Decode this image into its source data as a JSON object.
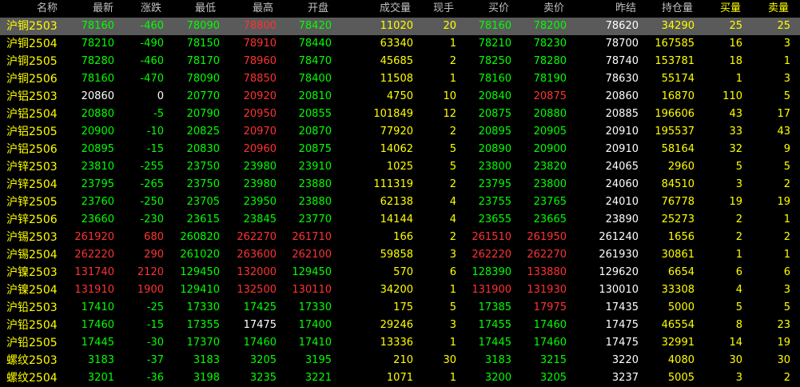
{
  "header": {
    "name": "名称",
    "latest": "最新",
    "change": "涨跌",
    "low": "最低",
    "high": "最高",
    "open": "开盘",
    "volume": "成交量",
    "current_hand": "现手",
    "bid": "买价",
    "ask": "卖价",
    "prev_settle": "昨结",
    "open_interest": "持仓量",
    "bid_vol": "买量",
    "ask_vol": "卖量"
  },
  "colors": {
    "up": "#ff3232",
    "down": "#00ff00",
    "flat": "#ffffff",
    "name": "#ffff00",
    "selected_row_bg": "#5a5a5a"
  },
  "rows": [
    {
      "name": "沪铜2503",
      "latest": "78160",
      "change": "-460",
      "low": "78090",
      "high": "78800",
      "open": "78420",
      "volume": "11020",
      "current_hand": "20",
      "bid": "78160",
      "ask": "78200",
      "prev_settle": "78620",
      "open_interest": "34290",
      "bid_vol": "25",
      "ask_vol": "25"
    },
    {
      "name": "沪铜2504",
      "latest": "78210",
      "change": "-490",
      "low": "78150",
      "high": "78910",
      "open": "78440",
      "volume": "63340",
      "current_hand": "1",
      "bid": "78210",
      "ask": "78230",
      "prev_settle": "78700",
      "open_interest": "167585",
      "bid_vol": "16",
      "ask_vol": "3"
    },
    {
      "name": "沪铜2505",
      "latest": "78280",
      "change": "-460",
      "low": "78170",
      "high": "78960",
      "open": "78470",
      "volume": "45685",
      "current_hand": "2",
      "bid": "78250",
      "ask": "78280",
      "prev_settle": "78740",
      "open_interest": "153781",
      "bid_vol": "18",
      "ask_vol": "1"
    },
    {
      "name": "沪铜2506",
      "latest": "78160",
      "change": "-470",
      "low": "78090",
      "high": "78850",
      "open": "78400",
      "volume": "11508",
      "current_hand": "1",
      "bid": "78160",
      "ask": "78190",
      "prev_settle": "78630",
      "open_interest": "55174",
      "bid_vol": "1",
      "ask_vol": "3"
    },
    {
      "name": "沪铝2503",
      "latest": "20860",
      "change": "0",
      "low": "20770",
      "high": "20920",
      "open": "20810",
      "volume": "4750",
      "current_hand": "10",
      "bid": "20840",
      "ask": "20875",
      "prev_settle": "20860",
      "open_interest": "16870",
      "bid_vol": "110",
      "ask_vol": "5"
    },
    {
      "name": "沪铝2504",
      "latest": "20880",
      "change": "-5",
      "low": "20790",
      "high": "20950",
      "open": "20855",
      "volume": "101849",
      "current_hand": "12",
      "bid": "20875",
      "ask": "20880",
      "prev_settle": "20885",
      "open_interest": "196606",
      "bid_vol": "43",
      "ask_vol": "17"
    },
    {
      "name": "沪铝2505",
      "latest": "20900",
      "change": "-10",
      "low": "20825",
      "high": "20970",
      "open": "20870",
      "volume": "77920",
      "current_hand": "2",
      "bid": "20895",
      "ask": "20905",
      "prev_settle": "20910",
      "open_interest": "195537",
      "bid_vol": "33",
      "ask_vol": "43"
    },
    {
      "name": "沪铝2506",
      "latest": "20895",
      "change": "-15",
      "low": "20830",
      "high": "20960",
      "open": "20875",
      "volume": "14062",
      "current_hand": "5",
      "bid": "20890",
      "ask": "20900",
      "prev_settle": "20910",
      "open_interest": "58164",
      "bid_vol": "32",
      "ask_vol": "9"
    },
    {
      "name": "沪锌2503",
      "latest": "23810",
      "change": "-255",
      "low": "23750",
      "high": "23980",
      "open": "23910",
      "volume": "1025",
      "current_hand": "5",
      "bid": "23800",
      "ask": "23820",
      "prev_settle": "24065",
      "open_interest": "2960",
      "bid_vol": "5",
      "ask_vol": "5"
    },
    {
      "name": "沪锌2504",
      "latest": "23795",
      "change": "-265",
      "low": "23750",
      "high": "23980",
      "open": "23880",
      "volume": "111319",
      "current_hand": "2",
      "bid": "23795",
      "ask": "23800",
      "prev_settle": "24060",
      "open_interest": "84510",
      "bid_vol": "3",
      "ask_vol": "2"
    },
    {
      "name": "沪锌2505",
      "latest": "23760",
      "change": "-250",
      "low": "23705",
      "high": "23950",
      "open": "23880",
      "volume": "62138",
      "current_hand": "4",
      "bid": "23755",
      "ask": "23765",
      "prev_settle": "24010",
      "open_interest": "76778",
      "bid_vol": "19",
      "ask_vol": "19"
    },
    {
      "name": "沪锌2506",
      "latest": "23660",
      "change": "-230",
      "low": "23615",
      "high": "23845",
      "open": "23770",
      "volume": "14144",
      "current_hand": "4",
      "bid": "23655",
      "ask": "23665",
      "prev_settle": "23890",
      "open_interest": "25273",
      "bid_vol": "2",
      "ask_vol": "1"
    },
    {
      "name": "沪锡2503",
      "latest": "261920",
      "change": "680",
      "low": "260820",
      "high": "262270",
      "open": "261710",
      "volume": "166",
      "current_hand": "2",
      "bid": "261510",
      "ask": "261950",
      "prev_settle": "261240",
      "open_interest": "1656",
      "bid_vol": "2",
      "ask_vol": "2"
    },
    {
      "name": "沪锡2504",
      "latest": "262220",
      "change": "290",
      "low": "261020",
      "high": "263600",
      "open": "262100",
      "volume": "59858",
      "current_hand": "3",
      "bid": "262220",
      "ask": "262270",
      "prev_settle": "261930",
      "open_interest": "30861",
      "bid_vol": "1",
      "ask_vol": "1"
    },
    {
      "name": "沪镍2503",
      "latest": "131740",
      "change": "2120",
      "low": "129450",
      "high": "132000",
      "open": "129450",
      "volume": "570",
      "current_hand": "6",
      "bid": "128390",
      "ask": "133880",
      "prev_settle": "129620",
      "open_interest": "6654",
      "bid_vol": "6",
      "ask_vol": "6"
    },
    {
      "name": "沪镍2504",
      "latest": "131910",
      "change": "1900",
      "low": "129410",
      "high": "132500",
      "open": "130110",
      "volume": "34200",
      "current_hand": "1",
      "bid": "131900",
      "ask": "131930",
      "prev_settle": "130010",
      "open_interest": "33308",
      "bid_vol": "4",
      "ask_vol": "3"
    },
    {
      "name": "沪铅2503",
      "latest": "17410",
      "change": "-25",
      "low": "17330",
      "high": "17425",
      "open": "17330",
      "volume": "175",
      "current_hand": "5",
      "bid": "17385",
      "ask": "17975",
      "prev_settle": "17435",
      "open_interest": "5000",
      "bid_vol": "5",
      "ask_vol": "5"
    },
    {
      "name": "沪铅2504",
      "latest": "17460",
      "change": "-15",
      "low": "17355",
      "high": "17475",
      "open": "17400",
      "volume": "29246",
      "current_hand": "3",
      "bid": "17455",
      "ask": "17460",
      "prev_settle": "17475",
      "open_interest": "46554",
      "bid_vol": "8",
      "ask_vol": "23"
    },
    {
      "name": "沪铅2505",
      "latest": "17445",
      "change": "-30",
      "low": "17370",
      "high": "17460",
      "open": "17410",
      "volume": "13336",
      "current_hand": "1",
      "bid": "17445",
      "ask": "17460",
      "prev_settle": "17475",
      "open_interest": "32991",
      "bid_vol": "14",
      "ask_vol": "19"
    },
    {
      "name": "螺纹2503",
      "latest": "3183",
      "change": "-37",
      "low": "3183",
      "high": "3205",
      "open": "3195",
      "volume": "210",
      "current_hand": "30",
      "bid": "3183",
      "ask": "3215",
      "prev_settle": "3220",
      "open_interest": "4080",
      "bid_vol": "30",
      "ask_vol": "30"
    },
    {
      "name": "螺纹2504",
      "latest": "3201",
      "change": "-36",
      "low": "3198",
      "high": "3235",
      "open": "3221",
      "volume": "1071",
      "current_hand": "1",
      "bid": "3200",
      "ask": "3205",
      "prev_settle": "3237",
      "open_interest": "5005",
      "bid_vol": "3",
      "ask_vol": "2"
    }
  ]
}
